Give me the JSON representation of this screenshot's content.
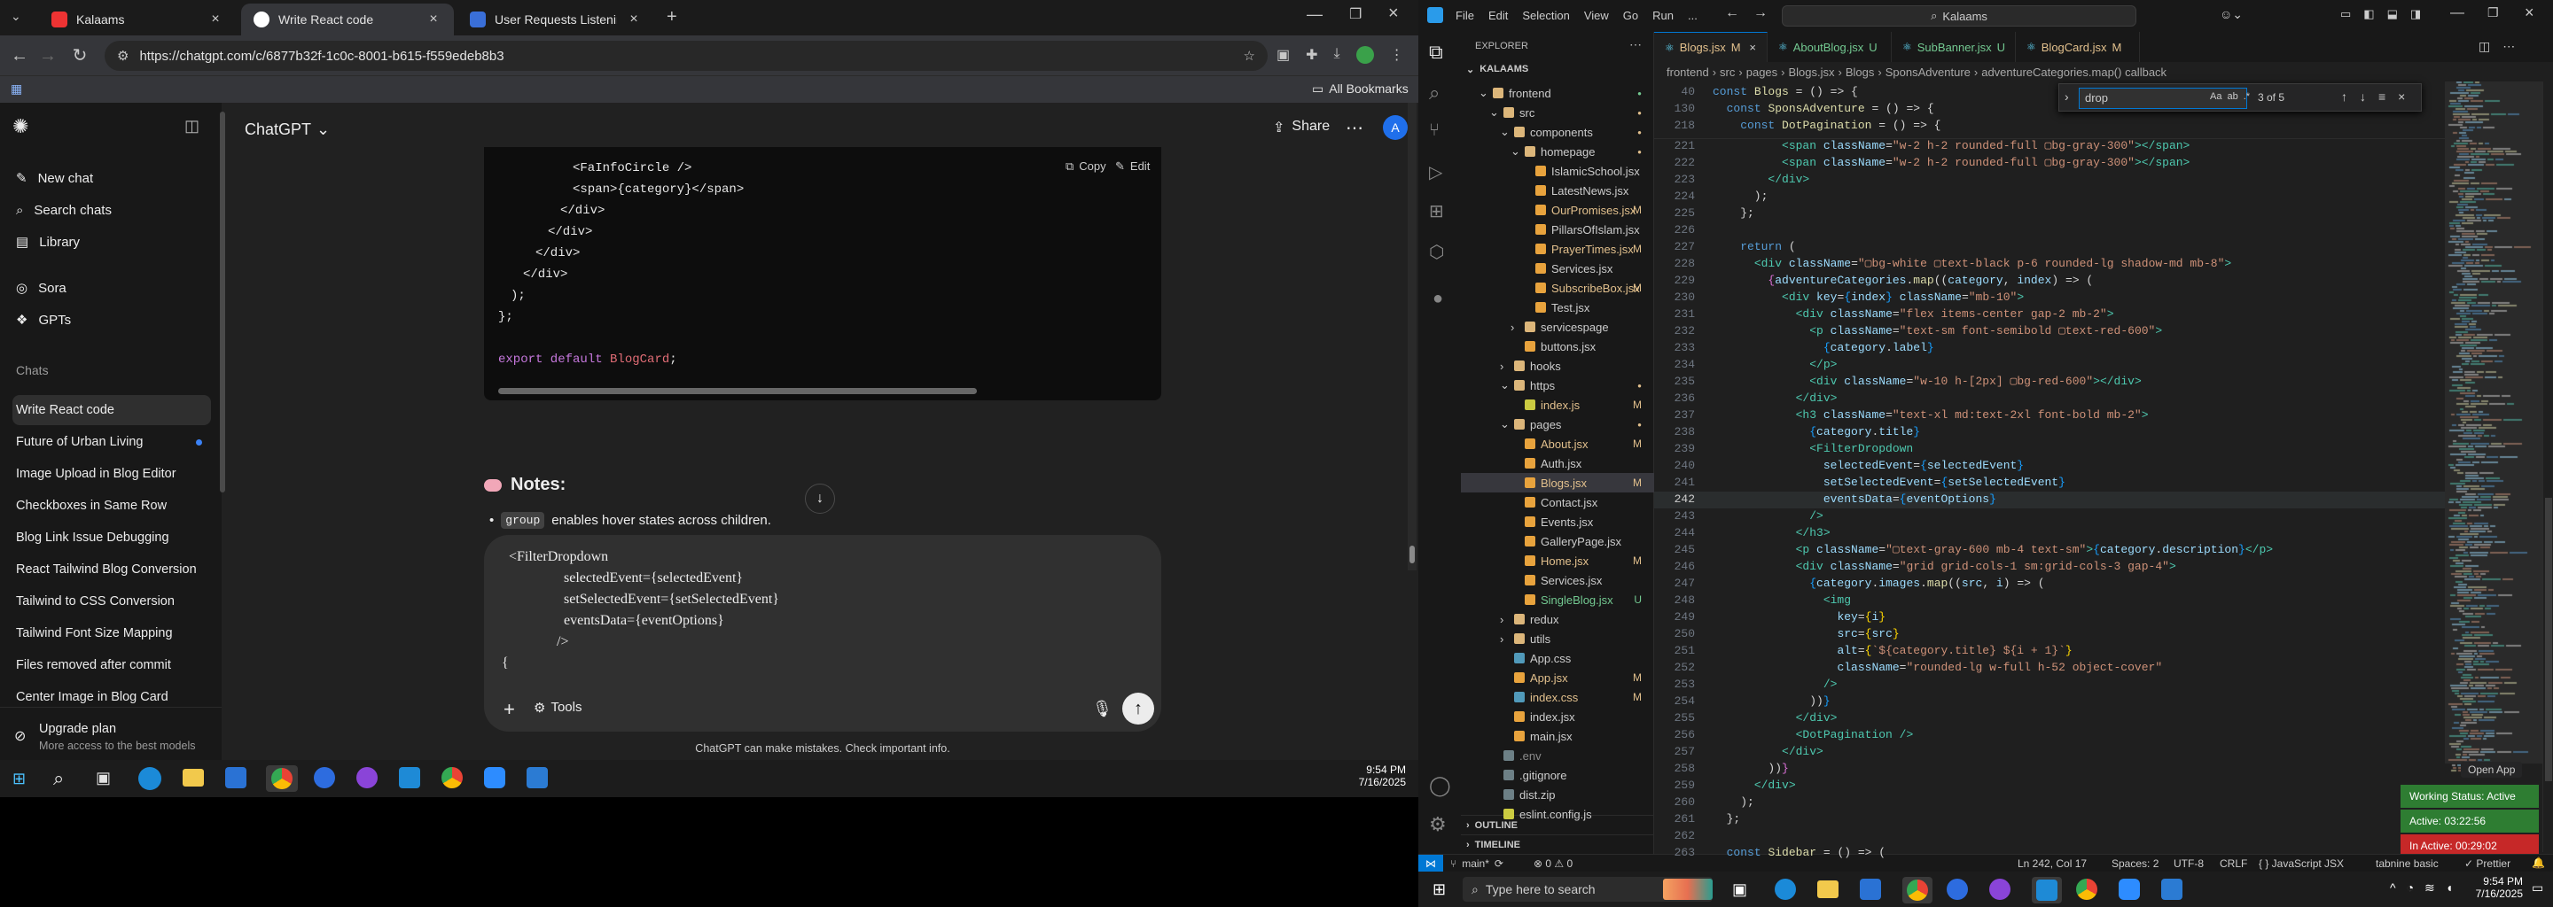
{
  "chrome": {
    "tabs": [
      {
        "label": "Kalaams",
        "active": false
      },
      {
        "label": "Write React code",
        "active": true
      },
      {
        "label": "User Requests Listening Assista",
        "active": false
      }
    ],
    "url": "https://chatgpt.com/c/6877b32f-1c0c-8001-b615-f559edeb8b3",
    "all_bookmarks": "All Bookmarks"
  },
  "chatgpt": {
    "model_title": "ChatGPT",
    "share_label": "Share",
    "avatar_letter": "A",
    "sidebar_items": [
      "New chat",
      "Search chats",
      "Library",
      "Sora",
      "GPTs"
    ],
    "chats_heading": "Chats",
    "chats": [
      "Write React code",
      "Future of Urban Living",
      "Image Upload in Blog Editor",
      "Checkboxes in Same Row",
      "Blog Link Issue Debugging",
      "React Tailwind Blog Conversion",
      "Tailwind to CSS Conversion",
      "Tailwind Font Size Mapping",
      "Files removed after commit",
      "Center Image in Blog Card"
    ],
    "upgrade_title": "Upgrade plan",
    "upgrade_sub": "More access to the best models",
    "code_copy": "Copy",
    "code_edit": "Edit",
    "code_lines": [
      "<FaInfoCircle />",
      "<span>{category}</span>",
      "</div>",
      "</div>",
      "</div>",
      "</div>",
      ");",
      "};",
      "",
      "export default BlogCard;"
    ],
    "notes_title": "Notes:",
    "notes_bullet_code": "group",
    "notes_bullet_text": "enables hover states across children.",
    "input_lines": [
      "<FilterDropdown",
      "selectedEvent={selectedEvent}",
      "setSelectedEvent={setSelectedEvent}",
      "eventsData={eventOptions}",
      "/>",
      "{"
    ],
    "tools_label": "Tools",
    "disclaimer": "ChatGPT can make mistakes. Check important info."
  },
  "taskbar_left": {
    "time": "9:54 PM",
    "date": "7/16/2025"
  },
  "vscode": {
    "menu": [
      "File",
      "Edit",
      "Selection",
      "View",
      "Go",
      "Run",
      "..."
    ],
    "search": "Kalaams",
    "explorer_title": "EXPLORER",
    "root_folder": "KALAAMS",
    "tree": [
      {
        "label": "frontend",
        "depth": 1,
        "type": "folder",
        "open": true,
        "dot": "green"
      },
      {
        "label": "src",
        "depth": 2,
        "type": "folder",
        "open": true,
        "dot": "orange"
      },
      {
        "label": "components",
        "depth": 3,
        "type": "folder",
        "open": true,
        "dot": "orange"
      },
      {
        "label": "homepage",
        "depth": 4,
        "type": "folder",
        "open": true,
        "dot": "orange"
      },
      {
        "label": "IslamicSchool.jsx",
        "depth": 5,
        "type": "file",
        "dec": "",
        "color": "#cccccc"
      },
      {
        "label": "LatestNews.jsx",
        "depth": 5,
        "type": "file",
        "dec": "",
        "color": "#cccccc"
      },
      {
        "label": "OurPromises.jsx",
        "depth": 5,
        "type": "file",
        "dec": "M",
        "color": "#e2c08d"
      },
      {
        "label": "PillarsOfIslam.jsx",
        "depth": 5,
        "type": "file",
        "dec": "",
        "color": "#cccccc"
      },
      {
        "label": "PrayerTimes.jsx",
        "depth": 5,
        "type": "file",
        "dec": "M",
        "color": "#e2c08d"
      },
      {
        "label": "Services.jsx",
        "depth": 5,
        "type": "file",
        "dec": "",
        "color": "#cccccc"
      },
      {
        "label": "SubscribeBox.jsx",
        "depth": 5,
        "type": "file",
        "dec": "M",
        "color": "#e2c08d"
      },
      {
        "label": "Test.jsx",
        "depth": 5,
        "type": "file",
        "dec": "",
        "color": "#cccccc"
      },
      {
        "label": "servicespage",
        "depth": 4,
        "type": "folder",
        "open": false,
        "dot": ""
      },
      {
        "label": "buttons.jsx",
        "depth": 4,
        "type": "file",
        "dec": "",
        "color": "#cccccc"
      },
      {
        "label": "hooks",
        "depth": 3,
        "type": "folder",
        "open": false,
        "dot": ""
      },
      {
        "label": "https",
        "depth": 3,
        "type": "folder",
        "open": true,
        "dot": "orange"
      },
      {
        "label": "index.js",
        "depth": 4,
        "type": "file",
        "dec": "M",
        "color": "#e2c08d"
      },
      {
        "label": "pages",
        "depth": 3,
        "type": "folder",
        "open": true,
        "dot": "orange"
      },
      {
        "label": "About.jsx",
        "depth": 4,
        "type": "file",
        "dec": "M",
        "color": "#e2c08d"
      },
      {
        "label": "Auth.jsx",
        "depth": 4,
        "type": "file",
        "dec": "",
        "color": "#cccccc"
      },
      {
        "label": "Blogs.jsx",
        "depth": 4,
        "type": "file",
        "dec": "M",
        "color": "#e2c08d",
        "selected": true
      },
      {
        "label": "Contact.jsx",
        "depth": 4,
        "type": "file",
        "dec": "",
        "color": "#cccccc"
      },
      {
        "label": "Events.jsx",
        "depth": 4,
        "type": "file",
        "dec": "",
        "color": "#cccccc"
      },
      {
        "label": "GalleryPage.jsx",
        "depth": 4,
        "type": "file",
        "dec": "",
        "color": "#cccccc"
      },
      {
        "label": "Home.jsx",
        "depth": 4,
        "type": "file",
        "dec": "M",
        "color": "#e2c08d"
      },
      {
        "label": "Services.jsx",
        "depth": 4,
        "type": "file",
        "dec": "",
        "color": "#cccccc"
      },
      {
        "label": "SingleBlog.jsx",
        "depth": 4,
        "type": "file",
        "dec": "U",
        "color": "#73c991"
      },
      {
        "label": "redux",
        "depth": 3,
        "type": "folder",
        "open": false,
        "dot": ""
      },
      {
        "label": "utils",
        "depth": 3,
        "type": "folder",
        "open": false,
        "dot": ""
      },
      {
        "label": "App.css",
        "depth": 3,
        "type": "file",
        "dec": "",
        "color": "#cccccc"
      },
      {
        "label": "App.jsx",
        "depth": 3,
        "type": "file",
        "dec": "M",
        "color": "#e2c08d"
      },
      {
        "label": "index.css",
        "depth": 3,
        "type": "file",
        "dec": "M",
        "color": "#e2c08d"
      },
      {
        "label": "index.jsx",
        "depth": 3,
        "type": "file",
        "dec": "",
        "color": "#cccccc"
      },
      {
        "label": "main.jsx",
        "depth": 3,
        "type": "file",
        "dec": "",
        "color": "#cccccc"
      },
      {
        "label": ".env",
        "depth": 2,
        "type": "file",
        "dec": "",
        "color": "#8b8b8b"
      },
      {
        "label": ".gitignore",
        "depth": 2,
        "type": "file",
        "dec": "",
        "color": "#cccccc"
      },
      {
        "label": "dist.zip",
        "depth": 2,
        "type": "file",
        "dec": "",
        "color": "#cccccc"
      },
      {
        "label": "eslint.config.js",
        "depth": 2,
        "type": "file",
        "dec": "",
        "color": "#cccccc"
      }
    ],
    "outline_label": "OUTLINE",
    "timeline_label": "TIMELINE",
    "tabs": [
      {
        "label": "Blogs.jsx",
        "dec": "M",
        "active": true
      },
      {
        "label": "AboutBlog.jsx",
        "dec": "U",
        "active": false
      },
      {
        "label": "SubBanner.jsx",
        "dec": "U",
        "active": false
      },
      {
        "label": "BlogCard.jsx",
        "dec": "M",
        "active": false
      }
    ],
    "breadcrumb": [
      "frontend",
      "src",
      "pages",
      "Blogs.jsx",
      "Blogs",
      "SponsAdventure",
      "adventureCategories.map() callback"
    ],
    "find_query": "drop",
    "find_result": "3 of 5",
    "sticky_lines": [
      {
        "n": "40",
        "html": "<span class='kw'>const</span> <span class='fn'>Blogs</span> = () => {"
      },
      {
        "n": "130",
        "html": "  <span class='kw'>const</span> <span class='fn'>SponsAdventure</span> = () => {"
      },
      {
        "n": "218",
        "html": "    <span class='kw'>const</span> <span class='fn'>DotPagination</span> = () => {"
      }
    ],
    "code": [
      {
        "n": "221",
        "html": "          <span class='tag'>&lt;span</span> <span class='attr'>className</span>=<span class='str'>\"w-2 h-2 rounded-full ▢bg-gray-300\"</span><span class='tag'>&gt;&lt;/span&gt;</span>"
      },
      {
        "n": "222",
        "html": "          <span class='tag'>&lt;span</span> <span class='attr'>className</span>=<span class='str'>\"w-2 h-2 rounded-full ▢bg-gray-300\"</span><span class='tag'>&gt;&lt;/span&gt;</span>"
      },
      {
        "n": "223",
        "html": "        <span class='tag'>&lt;/div&gt;</span>"
      },
      {
        "n": "224",
        "html": "      );"
      },
      {
        "n": "225",
        "html": "    };"
      },
      {
        "n": "226",
        "html": ""
      },
      {
        "n": "227",
        "html": "    <span class='kw'>return</span> ("
      },
      {
        "n": "228",
        "html": "      <span class='tag'>&lt;div</span> <span class='attr'>className</span>=<span class='str'>\"▢bg-white ▢text-black p-6 rounded-lg shadow-md mb-8\"</span><span class='tag'>&gt;</span>"
      },
      {
        "n": "229",
        "html": "        <span class='br2'>{</span><span class='var'>adventureCategories</span>.<span class='fn'>map</span>((<span class='var'>category</span>, <span class='var'>index</span>) => ("
      },
      {
        "n": "230",
        "html": "          <span class='tag'>&lt;div</span> <span class='attr'>key</span>=<span class='br3'>{</span><span class='var'>index</span><span class='br3'>}</span> <span class='attr'>className</span>=<span class='str'>\"mb-10\"</span><span class='tag'>&gt;</span>"
      },
      {
        "n": "231",
        "html": "            <span class='tag'>&lt;div</span> <span class='attr'>className</span>=<span class='str'>\"flex items-center gap-2 mb-2\"</span><span class='tag'>&gt;</span>"
      },
      {
        "n": "232",
        "html": "              <span class='tag'>&lt;p</span> <span class='attr'>className</span>=<span class='str'>\"text-sm font-semibold ▢text-red-600\"</span><span class='tag'>&gt;</span>"
      },
      {
        "n": "233",
        "html": "                <span class='br3'>{</span><span class='var'>category</span>.<span class='var'>label</span><span class='br3'>}</span>"
      },
      {
        "n": "234",
        "html": "              <span class='tag'>&lt;/p&gt;</span>"
      },
      {
        "n": "235",
        "html": "              <span class='tag'>&lt;div</span> <span class='attr'>className</span>=<span class='str'>\"w-10 h-[2px] ▢bg-red-600\"</span><span class='tag'>&gt;&lt;/div&gt;</span>"
      },
      {
        "n": "236",
        "html": "            <span class='tag'>&lt;/div&gt;</span>"
      },
      {
        "n": "237",
        "html": "            <span class='tag'>&lt;h3</span> <span class='attr'>className</span>=<span class='str'>\"text-xl md:text-2xl font-bold mb-2\"</span><span class='tag'>&gt;</span>"
      },
      {
        "n": "238",
        "html": "              <span class='br3'>{</span><span class='var'>category</span>.<span class='var'>title</span><span class='br3'>}</span>"
      },
      {
        "n": "239",
        "html": "              <span class='tag'>&lt;FilterDropdown</span>"
      },
      {
        "n": "240",
        "html": "                <span class='attr'>selectedEvent</span>=<span class='br3'>{</span><span class='var'>selectedEvent</span><span class='br3'>}</span>"
      },
      {
        "n": "241",
        "html": "                <span class='attr'>setSelectedEvent</span>=<span class='br3'>{</span><span class='var'>setSelectedEvent</span><span class='br3'>}</span>"
      },
      {
        "n": "242",
        "html": "                <span class='attr'>eventsData</span>=<span class='br3'>{</span><span class='var'>eventOptions</span><span class='br3'>}</span>"
      },
      {
        "n": "243",
        "html": "              <span class='tag'>/&gt;</span>"
      },
      {
        "n": "244",
        "html": "            <span class='tag'>&lt;/h3&gt;</span>"
      },
      {
        "n": "245",
        "html": "            <span class='tag'>&lt;p</span> <span class='attr'>className</span>=<span class='str'>\"▢text-gray-600 mb-4 text-sm\"</span><span class='tag'>&gt;</span><span class='br3'>{</span><span class='var'>category</span>.<span class='var'>description</span><span class='br3'>}</span><span class='tag'>&lt;/p&gt;</span>"
      },
      {
        "n": "246",
        "html": "            <span class='tag'>&lt;div</span> <span class='attr'>className</span>=<span class='str'>\"grid grid-cols-1 sm:grid-cols-3 gap-4\"</span><span class='tag'>&gt;</span>"
      },
      {
        "n": "247",
        "html": "              <span class='br3'>{</span><span class='var'>category</span>.<span class='var'>images</span>.<span class='fn'>map</span>((<span class='var'>src</span>, <span class='var'>i</span>) => ("
      },
      {
        "n": "248",
        "html": "                <span class='tag'>&lt;img</span>"
      },
      {
        "n": "249",
        "html": "                  <span class='attr'>key</span>=<span class='br'>{</span><span class='var'>i</span><span class='br'>}</span>"
      },
      {
        "n": "250",
        "html": "                  <span class='attr'>src</span>=<span class='br'>{</span><span class='var'>src</span><span class='br'>}</span>"
      },
      {
        "n": "251",
        "html": "                  <span class='attr'>alt</span>=<span class='br'>{</span><span class='str'>`${category.title} ${i + 1}`</span><span class='br'>}</span>"
      },
      {
        "n": "252",
        "html": "                  <span class='attr'>className</span>=<span class='str'>\"rounded-lg w-full h-52 object-cover\"</span>"
      },
      {
        "n": "253",
        "html": "                <span class='tag'>/&gt;</span>"
      },
      {
        "n": "254",
        "html": "              ))<span class='br3'>}</span>"
      },
      {
        "n": "255",
        "html": "            <span class='tag'>&lt;/div&gt;</span>"
      },
      {
        "n": "256",
        "html": "            <span class='tag'>&lt;DotPagination /&gt;</span>"
      },
      {
        "n": "257",
        "html": "          <span class='tag'>&lt;/div&gt;</span>"
      },
      {
        "n": "258",
        "html": "        ))<span class='br2'>}</span>"
      },
      {
        "n": "259",
        "html": "      <span class='tag'>&lt;/div&gt;</span>"
      },
      {
        "n": "260",
        "html": "    );"
      },
      {
        "n": "261",
        "html": "  };"
      },
      {
        "n": "262",
        "html": ""
      },
      {
        "n": "263",
        "html": "  <span class='kw'>const</span> <span class='fn'>Sidebar</span> = () => ("
      }
    ],
    "open_app": "Open App",
    "working_status": "Working Status: Active",
    "active_time": "Active: 03:22:56",
    "inactive_time": "In Active: 00:29:02",
    "status": {
      "branch": "main*",
      "problems": "⊗ 0 ⚠ 0",
      "position": "Ln 242, Col 17",
      "spaces": "Spaces: 2",
      "encoding": "UTF-8",
      "eol": "CRLF",
      "language": "{ } JavaScript JSX",
      "tabnine": "tabnine basic",
      "prettier": "✓ Prettier"
    }
  },
  "taskbar_right": {
    "search_placeholder": "Type here to search",
    "time": "9:54 PM",
    "date": "7/16/2025"
  }
}
